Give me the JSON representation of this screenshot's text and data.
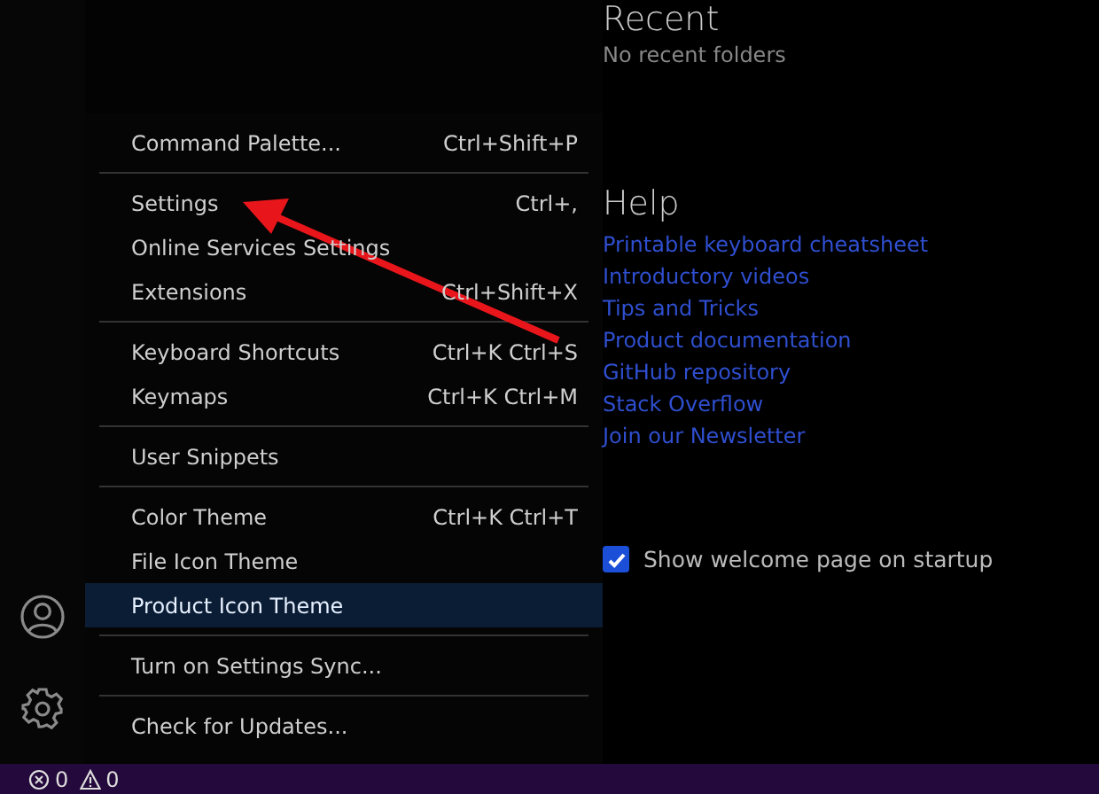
{
  "menu": {
    "groups": [
      [
        {
          "label": "Command Palette...",
          "shortcut": "Ctrl+Shift+P",
          "selected": false
        }
      ],
      [
        {
          "label": "Settings",
          "shortcut": "Ctrl+,",
          "selected": false
        },
        {
          "label": "Online Services Settings",
          "selected": false
        },
        {
          "label": "Extensions",
          "shortcut": "Ctrl+Shift+X",
          "selected": false
        }
      ],
      [
        {
          "label": "Keyboard Shortcuts",
          "shortcut": "Ctrl+K Ctrl+S",
          "selected": false
        },
        {
          "label": "Keymaps",
          "shortcut": "Ctrl+K Ctrl+M",
          "selected": false
        }
      ],
      [
        {
          "label": "User Snippets",
          "selected": false
        }
      ],
      [
        {
          "label": "Color Theme",
          "shortcut": "Ctrl+K Ctrl+T",
          "selected": false
        },
        {
          "label": "File Icon Theme",
          "selected": false
        },
        {
          "label": "Product Icon Theme",
          "selected": true
        }
      ],
      [
        {
          "label": "Turn on Settings Sync...",
          "selected": false
        }
      ],
      [
        {
          "label": "Check for Updates...",
          "selected": false
        }
      ]
    ]
  },
  "recent": {
    "title": "Recent",
    "empty_text": "No recent folders"
  },
  "help": {
    "title": "Help",
    "links": [
      "Printable keyboard cheatsheet",
      "Introductory videos",
      "Tips and Tricks",
      "Product documentation",
      "GitHub repository",
      "Stack Overflow",
      "Join our Newsletter"
    ]
  },
  "startup_checkbox": {
    "label": "Show welcome page on startup",
    "checked": true
  },
  "status_bar": {
    "errors": "0",
    "warnings": "0"
  }
}
